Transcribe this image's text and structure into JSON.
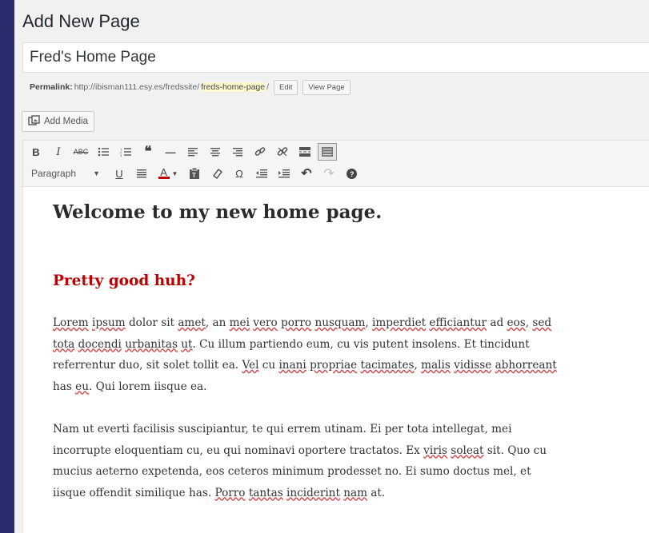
{
  "header": {
    "title": "Add New Page"
  },
  "post": {
    "title": "Fred's Home Page"
  },
  "permalink": {
    "label": "Permalink:",
    "base": "http://ibisman111.esy.es/fredssite/",
    "slug": "freds-home-page",
    "trail": "/",
    "edit_label": "Edit",
    "view_label": "View Page"
  },
  "media": {
    "add_label": "Add Media",
    "icon": "media-icon"
  },
  "toolbar": {
    "format_value": "Paragraph",
    "row1_icons": [
      "bold-icon",
      "italic-icon",
      "strikethrough-icon",
      "bullet-list-icon",
      "numbered-list-icon",
      "blockquote-icon",
      "horizontal-rule-icon",
      "align-left-icon",
      "align-center-icon",
      "align-right-icon",
      "link-icon",
      "unlink-icon",
      "read-more-icon",
      "toolbar-toggle-icon"
    ],
    "row2_icons": [
      "underline-icon",
      "justify-icon",
      "text-color-icon",
      "paste-text-icon",
      "clear-formatting-icon",
      "special-character-icon",
      "outdent-icon",
      "indent-icon",
      "undo-icon",
      "redo-icon",
      "help-icon"
    ]
  },
  "editor": {
    "heading": "Welcome to my new home page.",
    "subheading": "Pretty good huh?",
    "paragraph1": [
      {
        "t": "Lorem",
        "s": true
      },
      {
        "t": " "
      },
      {
        "t": "ipsum",
        "s": true
      },
      {
        "t": " dolor sit "
      },
      {
        "t": "amet",
        "s": true
      },
      {
        "t": ", an "
      },
      {
        "t": "mei",
        "s": true
      },
      {
        "t": " "
      },
      {
        "t": "vero",
        "s": true
      },
      {
        "t": " "
      },
      {
        "t": "porro",
        "s": true
      },
      {
        "t": " "
      },
      {
        "t": "nusquam",
        "s": true
      },
      {
        "t": ", "
      },
      {
        "t": "imperdiet",
        "s": true
      },
      {
        "t": " "
      },
      {
        "t": "efficiantur",
        "s": true
      },
      {
        "t": " ad "
      },
      {
        "t": "eos",
        "s": true
      },
      {
        "t": ", "
      },
      {
        "t": "sed",
        "s": true
      },
      {
        "t": " "
      },
      {
        "t": "tota",
        "s": true
      },
      {
        "t": " "
      },
      {
        "t": "docendi",
        "s": true
      },
      {
        "t": " "
      },
      {
        "t": "urbanitas",
        "s": true
      },
      {
        "t": " "
      },
      {
        "t": "ut",
        "s": true
      },
      {
        "t": ". Cu illum partiendo eum, cu vis putent insolens. Et tincidunt referrentur duo, sit solet tollit ea. "
      },
      {
        "t": "Vel",
        "s": true
      },
      {
        "t": " cu "
      },
      {
        "t": "inani",
        "s": true
      },
      {
        "t": " "
      },
      {
        "t": "propriae",
        "s": true
      },
      {
        "t": " "
      },
      {
        "t": "tacimates",
        "s": true
      },
      {
        "t": ", "
      },
      {
        "t": "malis",
        "s": true
      },
      {
        "t": " "
      },
      {
        "t": "vidisse",
        "s": true
      },
      {
        "t": " "
      },
      {
        "t": "abhorreant",
        "s": true
      },
      {
        "t": " has "
      },
      {
        "t": "eu",
        "s": true
      },
      {
        "t": ". Qui lorem iisque ea."
      }
    ],
    "paragraph2": [
      {
        "t": "Nam ut everti facilisis suscipiantur, te qui errem utinam. Ei per tota intellegat, mei incorrupte eloquentiam cu, eu qui nominavi oportere tractatos. Ex "
      },
      {
        "t": "viris",
        "s": true
      },
      {
        "t": " "
      },
      {
        "t": "soleat",
        "s": true
      },
      {
        "t": " sit. Quo cu mucius aeterno expetenda, eos ceteros minimum prodesset no. Ei sumo doctus mel, et iisque offendit similique has. "
      },
      {
        "t": "Porro",
        "s": true
      },
      {
        "t": " "
      },
      {
        "t": "tantas",
        "s": true
      },
      {
        "t": " "
      },
      {
        "t": "inciderint",
        "s": true
      },
      {
        "t": " "
      },
      {
        "t": "nam",
        "s": true
      },
      {
        "t": " at."
      }
    ]
  }
}
